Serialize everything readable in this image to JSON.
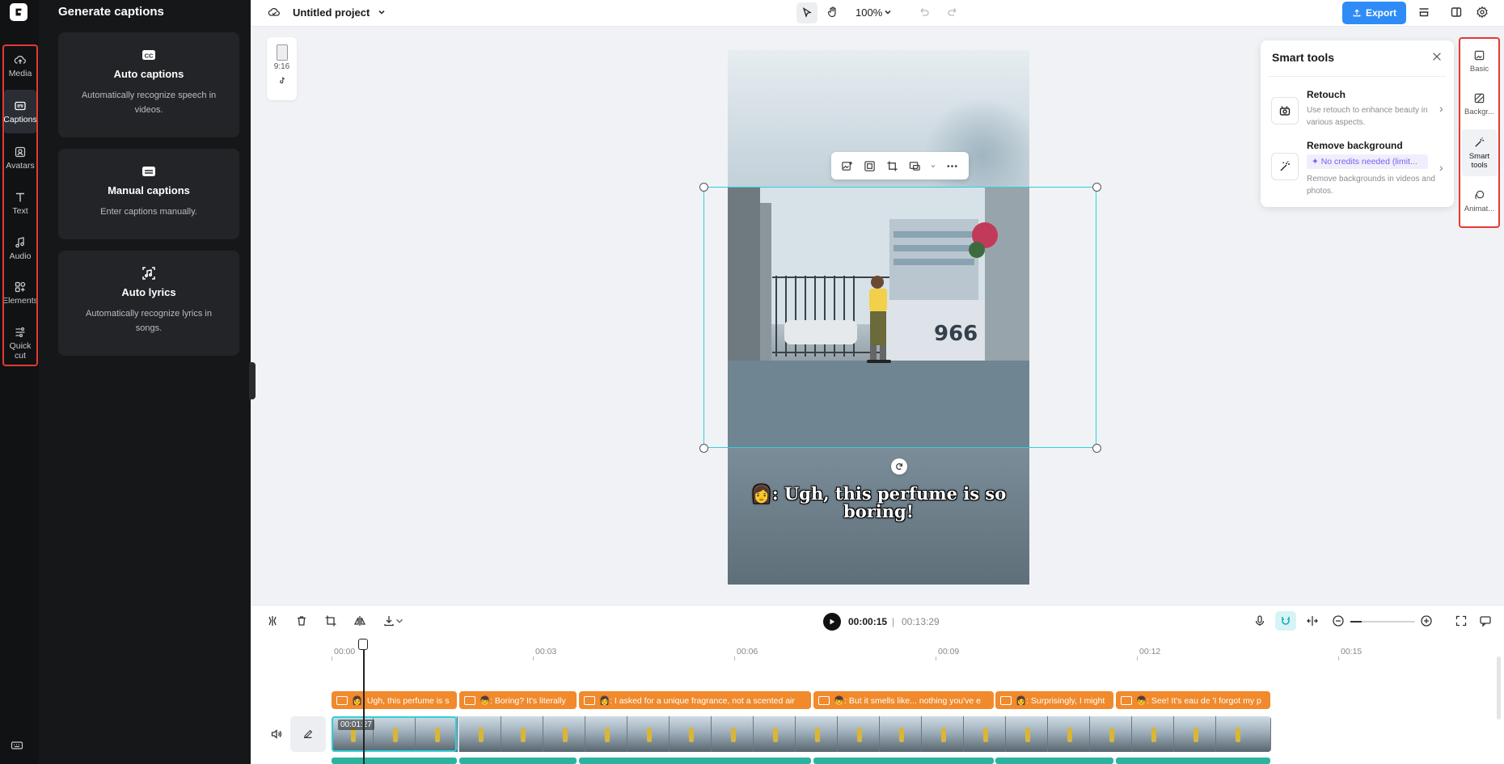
{
  "left_rail": {
    "items": [
      {
        "label": "Media",
        "icon": "cloud-upload-icon"
      },
      {
        "label": "Captions",
        "icon": "captions-icon",
        "active": true
      },
      {
        "label": "Avatars",
        "icon": "avatar-icon"
      },
      {
        "label": "Text",
        "icon": "text-icon"
      },
      {
        "label": "Audio",
        "icon": "music-note-icon"
      },
      {
        "label": "Elements",
        "icon": "elements-icon"
      },
      {
        "label": "Quick cut",
        "icon": "scissors-icon"
      }
    ]
  },
  "panel": {
    "title": "Generate captions",
    "cards": [
      {
        "title": "Auto captions",
        "description": "Automatically recognize speech in videos.",
        "icon": "cc-icon"
      },
      {
        "title": "Manual captions",
        "description": "Enter captions manually.",
        "icon": "keyboard-icon"
      },
      {
        "title": "Auto lyrics",
        "description": "Automatically recognize lyrics in songs.",
        "icon": "lyrics-icon"
      }
    ]
  },
  "topbar": {
    "project_title": "Untitled project",
    "zoom": "100%",
    "export_label": "Export"
  },
  "ratio": {
    "label": "9:16"
  },
  "preview": {
    "caption": "👩: Ugh, this perfume is so boring!"
  },
  "smart_tools": {
    "title": "Smart tools",
    "tools": [
      {
        "name": "Retouch",
        "description": "Use retouch to enhance beauty in various aspects."
      },
      {
        "name": "Remove background",
        "badge": "✦ No credits needed (limit...",
        "description": "Remove backgrounds in videos and photos."
      }
    ]
  },
  "right_rail": {
    "items": [
      {
        "label": "Basic"
      },
      {
        "label": "Backgr..."
      },
      {
        "label": "Smart tools",
        "active": true
      },
      {
        "label": "Animat..."
      }
    ]
  },
  "timeline": {
    "current_time": "00:00:15",
    "separator": "|",
    "total_time": "00:13:29",
    "ruler": [
      "00:00",
      "00:03",
      "00:06",
      "00:09",
      "00:12",
      "00:15"
    ],
    "clip_time": "00:01:27",
    "caption_clips": [
      "👩: Ugh, this perfume is s",
      "👦: Boring? It's literally",
      "👩: I asked for a unique fragrance, not a scented air",
      "👦: But it smells like... nothing you've e",
      "👩: Surprisingly, I might",
      "👦: See! It's eau de 'I forgot my p"
    ]
  },
  "colors": {
    "accent": "#2f8cf7",
    "selection": "#2fd0d8",
    "caption_clip": "#f08a2c",
    "highlight_box": "#e53935"
  }
}
